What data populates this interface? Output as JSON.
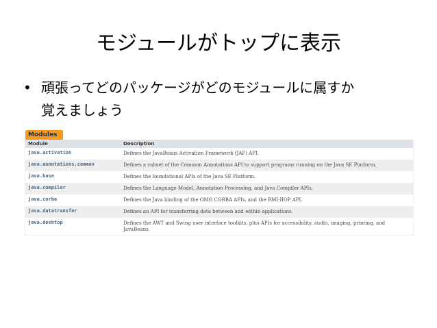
{
  "slide": {
    "title": "モジュールがトップに表示",
    "bullet_symbol": "•",
    "bullet_line1": "頑張ってどのパッケージがどのモジュールに属すか",
    "bullet_line2": "覚えましょう"
  },
  "modules": {
    "tab_label": "Modules",
    "header_module": "Module",
    "header_description": "Description",
    "rows": [
      {
        "module": "java.activation",
        "description": "Defines the JavaBeans Activation Framework (JAF) API."
      },
      {
        "module": "java.annotations.common",
        "description": "Defines a subset of the Common Annotations API to support programs running on the Java SE Platform."
      },
      {
        "module": "java.base",
        "description": "Defines the foundational APIs of the Java SE Platform."
      },
      {
        "module": "java.compiler",
        "description": "Defines the Language Model, Annotation Processing, and Java Compiler APIs."
      },
      {
        "module": "java.corba",
        "description": "Defines the Java binding of the OMG CORBA APIs, and the RMI-IIOP API."
      },
      {
        "module": "java.datatransfer",
        "description": "Defines an API for transferring data between and within applications."
      },
      {
        "module": "java.desktop",
        "description": "Defines the AWT and Swing user interface toolkits, plus APIs for accessibility, audio, imaging, printing, and JavaBeans."
      }
    ]
  },
  "colors": {
    "tab_orange": "#f8981d",
    "header_bg": "#dee3e9",
    "link_blue": "#4a6782",
    "stripe": "#eeeeef"
  }
}
